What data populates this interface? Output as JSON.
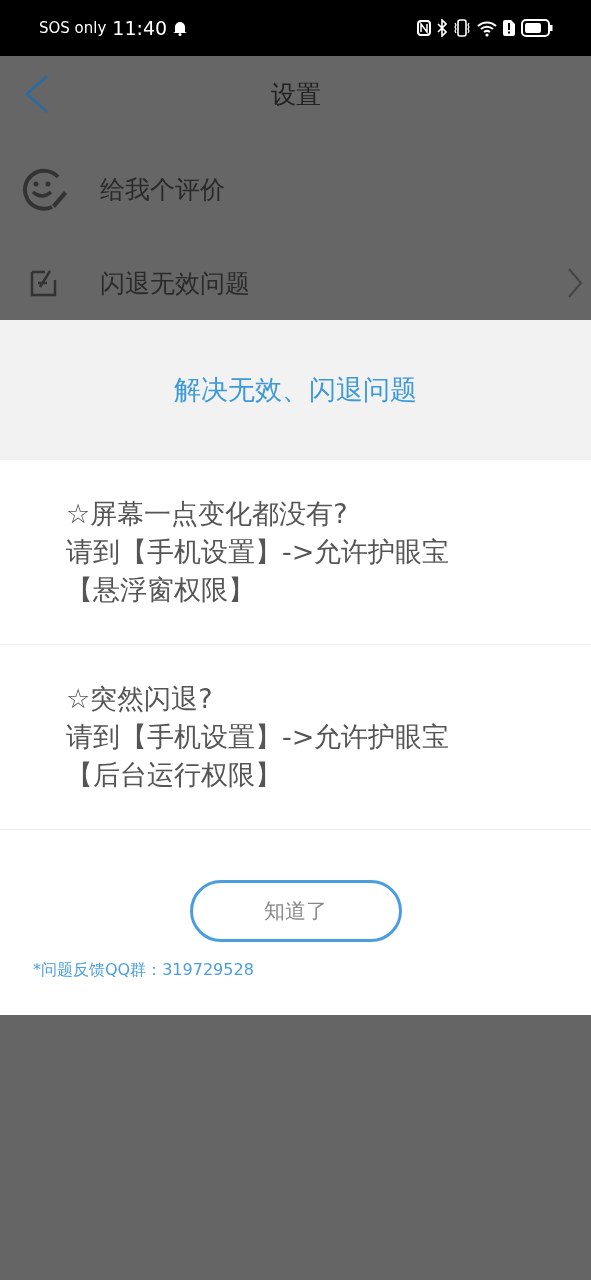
{
  "status_bar": {
    "carrier": "SOS only",
    "time": "11:40"
  },
  "header": {
    "title": "设置"
  },
  "settings_items": [
    {
      "kind": "rate",
      "label": "给我个评价",
      "has_chevron": false
    },
    {
      "kind": "issue",
      "label": "闪退无效问题",
      "has_chevron": true
    }
  ],
  "dialog": {
    "title": "解决无效、闪退问题",
    "tips": [
      {
        "lines": [
          "☆屏幕一点变化都没有?",
          "请到【手机设置】->允许护眼宝",
          "【悬浮窗权限】"
        ]
      },
      {
        "lines": [
          "☆突然闪退?",
          "请到【手机设置】->允许护眼宝",
          "【后台运行权限】"
        ]
      }
    ],
    "button": "知道了",
    "footer": "*问题反馈QQ群：319729528"
  }
}
